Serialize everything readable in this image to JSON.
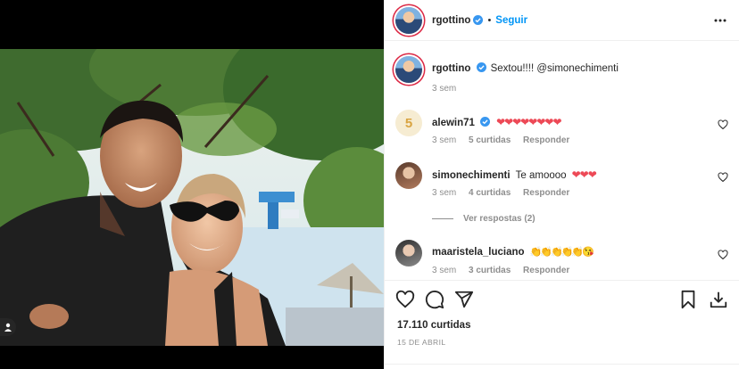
{
  "post": {
    "username": "rgottino",
    "follow_label": "Seguir",
    "separator": "•",
    "caption_user": "rgottino",
    "caption_text": "Sextou!!!! @simonechimenti",
    "caption_time": "3 sem"
  },
  "comments": [
    {
      "username": "alewin71",
      "text": "❤❤❤❤❤❤❤❤",
      "time": "3 sem",
      "likes": "5 curtidas",
      "reply": "Responder",
      "verified": true
    },
    {
      "username": "simonechimenti",
      "text": "Te amoooo",
      "emoji": "❤❤❤",
      "time": "3 sem",
      "likes": "4 curtidas",
      "reply": "Responder"
    },
    {
      "username": "maaristela_luciano",
      "emoji": "👏👏👏👏👏😘",
      "time": "3 sem",
      "likes": "3 curtidas",
      "reply": "Responder"
    }
  ],
  "view_replies": "Ver respostas (2)",
  "footer": {
    "likes": "17.110 curtidas",
    "date": "15 DE ABRIL"
  },
  "colors": {
    "accent": "#0095f6",
    "heart": "#ed4956",
    "muted": "#8e8e8e"
  },
  "icons": [
    "verified-icon",
    "more-icon",
    "heart-icon",
    "comment-icon",
    "share-icon",
    "bookmark-icon",
    "download-icon",
    "user-tag-icon"
  ]
}
